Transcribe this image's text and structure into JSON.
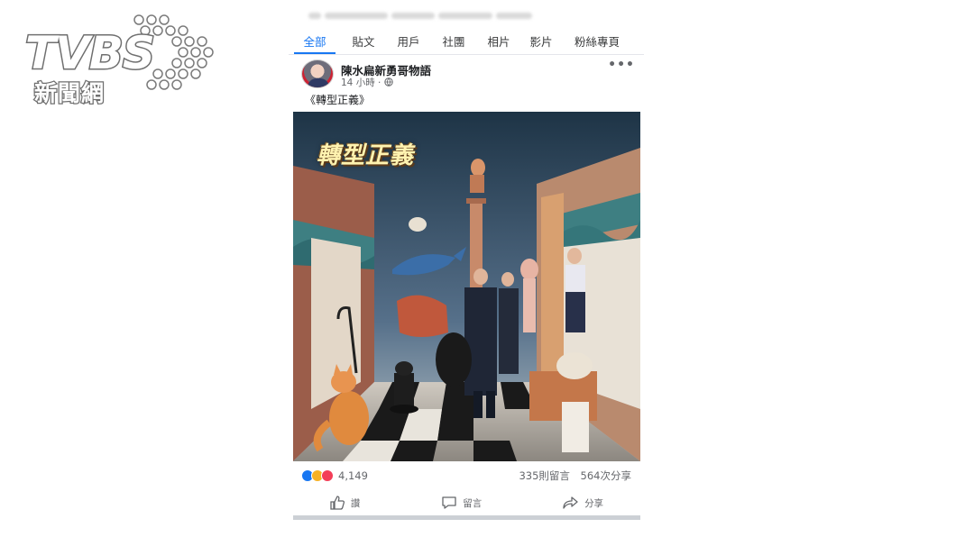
{
  "logo": {
    "word": "TVBS",
    "sub": "新聞網"
  },
  "nav": {
    "tabs": [
      "全部",
      "貼文",
      "用戶",
      "社團",
      "相片",
      "影片",
      "粉絲專頁"
    ],
    "active_index": 0
  },
  "post": {
    "author": "陳水扁新勇哥物語",
    "time": "14 小時 ·",
    "privacy_icon": "globe-icon",
    "more_icon": "more-dots-icon",
    "caption": "《轉型正義》",
    "image_title": "轉型正義",
    "reactions": {
      "icons": [
        "like",
        "haha",
        "love"
      ],
      "count": "4,149"
    },
    "comments": "335則留言",
    "shares": "564次分享",
    "actions": [
      {
        "icon": "thumbs-up-icon",
        "label": "讚"
      },
      {
        "icon": "comment-icon",
        "label": "留言"
      },
      {
        "icon": "share-icon",
        "label": "分享"
      }
    ]
  },
  "colors": {
    "accent": "#1877f2",
    "muted": "#65676b"
  }
}
